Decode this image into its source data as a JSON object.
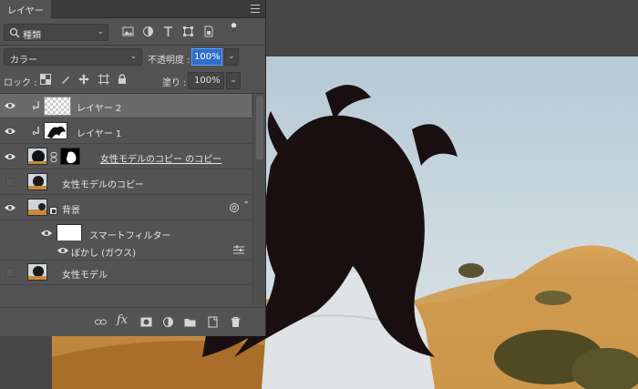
{
  "panel": {
    "tab_label": "レイヤー",
    "filter": {
      "kind_label": "種類"
    },
    "blend_mode": "カラー",
    "opacity_label": "不透明度 :",
    "opacity_value": "100%",
    "lock_label": "ロック :",
    "fill_label": "塗り :",
    "fill_value": "100%"
  },
  "layers": [
    {
      "name": "レイヤー 2",
      "visible": true,
      "selected": true
    },
    {
      "name": "レイヤー 1",
      "visible": true
    },
    {
      "name": "女性モデルのコピー のコピー",
      "visible": true
    },
    {
      "name": "女性モデルのコピー",
      "visible": false
    },
    {
      "name": "背景",
      "visible": true
    },
    {
      "name": "スマートフィルター",
      "visible": true
    },
    {
      "name": "ぼかし (ガウス)",
      "visible": true
    },
    {
      "name": "女性モデル",
      "visible": false
    }
  ],
  "colors": {
    "selection": "#6a6a6a",
    "opacity_highlight": "#2e6fc9",
    "panel_bg": "#535353"
  }
}
